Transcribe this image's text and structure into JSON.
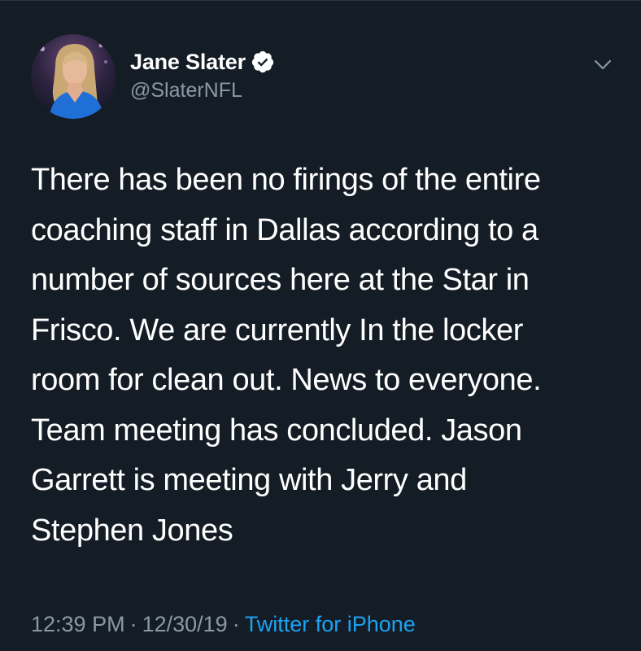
{
  "tweet": {
    "author": {
      "display_name": "Jane Slater",
      "handle": "@SlaterNFL",
      "verified": true,
      "avatar_icon": "profile-photo"
    },
    "text": "There has been no firings of the entire\ncoaching staff in Dallas according to a\nnumber of sources here at the Star in\nFrisco. We are currently In the locker\nroom for clean out. News to everyone.\nTeam meeting has concluded. Jason\nGarrett is meeting with Jerry and\nStephen Jones",
    "meta": {
      "time": "12:39 PM",
      "separator": "·",
      "date": "12/30/19",
      "source": "Twitter for iPhone"
    },
    "menu_icon": "chevron-down-icon"
  },
  "colors": {
    "background": "#141d26",
    "primary_text": "#ffffff",
    "secondary_text": "#8899a6",
    "link": "#1da1f2",
    "verified_badge": "#ffffff"
  }
}
